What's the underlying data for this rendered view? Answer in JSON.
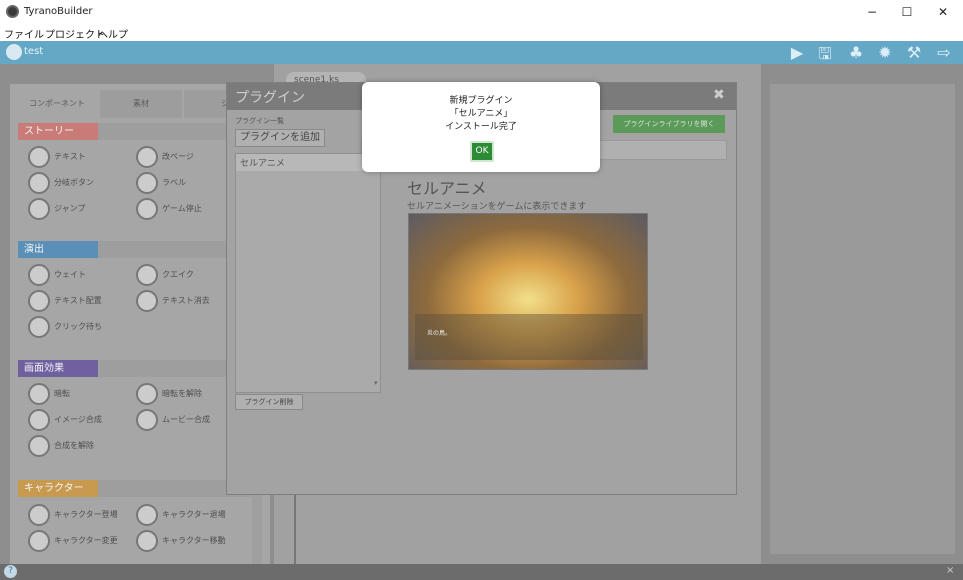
{
  "window": {
    "title": "TyranoBuilder",
    "minimize": "−",
    "maximize": "☐",
    "close": "✕"
  },
  "menu": [
    "ファイル",
    "プロジェクト",
    "ヘルプ"
  ],
  "toolbar": {
    "project": "test",
    "icons": [
      "play-icon",
      "save-icon",
      "users-gear-icon",
      "gear-icon",
      "hammer-icon",
      "export-icon"
    ]
  },
  "left_tabs": [
    "コンポーネント",
    "素材",
    "シ"
  ],
  "sections": [
    {
      "title": "ストーリー",
      "color": "#c97b78",
      "items": [
        "テキスト",
        "改ページ",
        "分岐ボタン",
        "ラベル",
        "ジャンプ",
        "ゲーム停止"
      ]
    },
    {
      "title": "演出",
      "color": "#5a8fb8",
      "items": [
        "ウェイト",
        "クエイク",
        "テキスト配置",
        "テキスト消去",
        "クリック待ち"
      ]
    },
    {
      "title": "画面効果",
      "color": "#7060a0",
      "items": [
        "暗転",
        "暗転を解除",
        "イメージ合成",
        "ムービー合成",
        "合成を解除"
      ]
    },
    {
      "title": "キャラクター",
      "color": "#c89a50",
      "items": [
        "キャラクター登場",
        "キャラクター退場",
        "キャラクター変更",
        "キャラクター移動"
      ]
    }
  ],
  "scene_tab": "scene1.ks",
  "dialog": {
    "title": "プラグイン",
    "close": "✖",
    "list_label": "プラグイン一覧",
    "add_button": "プラグインを追加",
    "library_button": "プラグインライブラリを開く",
    "list_items": [
      "セルアニメ"
    ],
    "delete_button": "プラグイン削除",
    "plugin_name": "セルアニメ",
    "plugin_desc": "セルアニメーションをゲームに表示できます",
    "preview_caption": "炎の鳥。"
  },
  "popup": {
    "line1": "新規プラグイン",
    "line2": "「セルアニメ」",
    "line3": "インストール完了",
    "ok": "OK"
  },
  "status": {
    "help": "?",
    "close": "×"
  }
}
